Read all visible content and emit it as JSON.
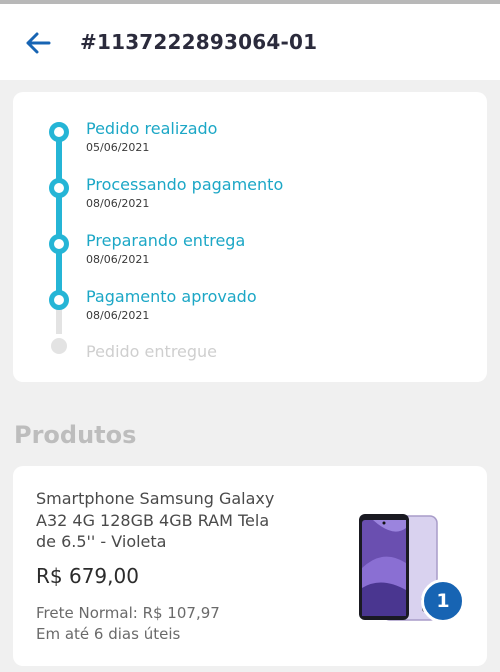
{
  "header": {
    "order_number": "#1137222893064-01",
    "back_icon": "arrow-left-icon",
    "accent_color": "#1764b3"
  },
  "timeline": {
    "active_color": "#25b5d6",
    "inactive_color": "#e3e3e3",
    "steps": [
      {
        "label": "Pedido realizado",
        "date": "05/06/2021",
        "completed": true
      },
      {
        "label": "Processando pagamento",
        "date": "08/06/2021",
        "completed": true
      },
      {
        "label": "Preparando entrega",
        "date": "08/06/2021",
        "completed": true
      },
      {
        "label": "Pagamento aprovado",
        "date": "08/06/2021",
        "completed": true
      },
      {
        "label": "Pedido entregue",
        "date": "",
        "completed": false
      }
    ]
  },
  "products": {
    "section_title": "Produtos",
    "items": [
      {
        "name": "Smartphone Samsung Galaxy A32 4G 128GB 4GB RAM Tela de 6.5'' - Violeta",
        "price": "R$ 679,00",
        "shipping": "Frete Normal: R$ 107,97",
        "delivery": "Em até 6 dias úteis",
        "quantity": "1",
        "image_icon": "smartphone-icon"
      }
    ]
  }
}
